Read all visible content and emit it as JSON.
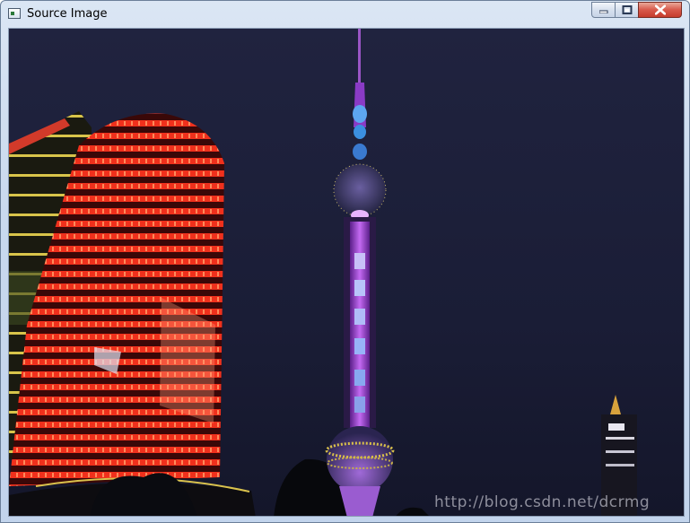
{
  "window": {
    "title": "Source Image",
    "controls": {
      "minimize": "minimize",
      "maximize": "maximize",
      "close": "close"
    }
  },
  "image": {
    "subject": "night-city-skyline-photo",
    "watermark": "http://blog.csdn.net/dcrmg"
  },
  "colors": {
    "titlebar": "#c9d9ee",
    "close_button": "#c53b2c",
    "sky": "#1b1f3a",
    "tower_glow": "#b04be0",
    "building_lights": "#e8321f"
  }
}
